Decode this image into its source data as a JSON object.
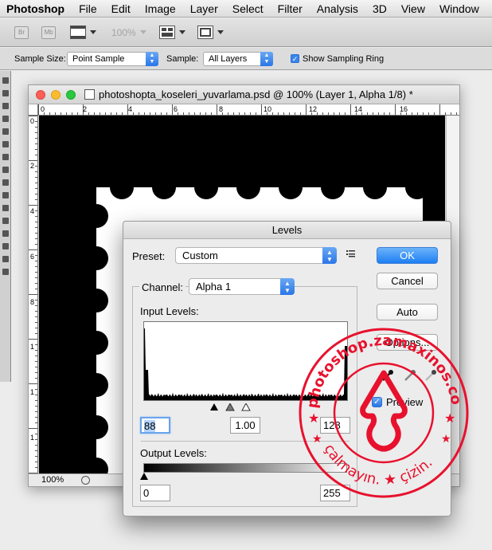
{
  "menubar": {
    "app": "Photoshop",
    "items": [
      "File",
      "Edit",
      "Image",
      "Layer",
      "Select",
      "Filter",
      "Analysis",
      "3D",
      "View",
      "Window"
    ]
  },
  "appbar": {
    "br_label": "Br",
    "mb_label": "Mb",
    "zoom": "100%"
  },
  "options": {
    "sample_size_label": "Sample Size:",
    "sample_size_value": "Point Sample",
    "sample_label": "Sample:",
    "sample_value": "All Layers",
    "show_ring_label": "Show Sampling Ring",
    "show_ring_checked": true
  },
  "document": {
    "title": "photoshopta_koseleri_yuvarlama.psd @ 100% (Layer 1, Alpha 1/8) *",
    "zoom": "100%",
    "ruler_h": [
      "0",
      "2",
      "4",
      "6",
      "8",
      "10",
      "12",
      "14",
      "16"
    ],
    "ruler_v": [
      "0",
      "2",
      "4",
      "6",
      "8",
      "1",
      "1",
      "1"
    ]
  },
  "levels": {
    "title": "Levels",
    "preset_label": "Preset:",
    "preset_value": "Custom",
    "channel_label": "Channel:",
    "channel_value": "Alpha 1",
    "input_levels_label": "Input Levels:",
    "input_black": "88",
    "input_gamma": "1.00",
    "input_white": "128",
    "output_levels_label": "Output Levels:",
    "output_black": "0",
    "output_white": "255",
    "buttons": {
      "ok": "OK",
      "cancel": "Cancel",
      "auto": "Auto",
      "options": "Options..."
    },
    "preview_label": "Preview",
    "preview_checked": true
  },
  "watermark": {
    "top_text": "photoshop.zamaxinos.com",
    "bottom_text": "çalmayın. ★ çizin."
  },
  "colors": {
    "accent_blue": "#2a76e8",
    "watermark_red": "#e8112d"
  }
}
